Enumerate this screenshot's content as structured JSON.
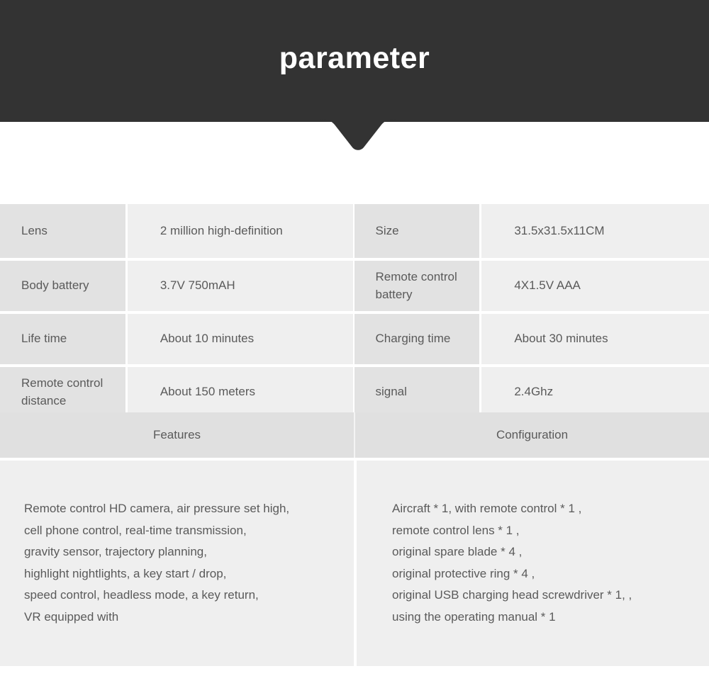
{
  "header": {
    "title": "parameter",
    "background_color": "#333333",
    "text_color": "#ffffff"
  },
  "spec_table": {
    "rows": [
      {
        "left_label": "Lens",
        "left_value": "2 million high-definition",
        "right_label": "Size",
        "right_value": "31.5x31.5x11CM"
      },
      {
        "left_label": "Body battery",
        "left_value": "3.7V 750mAH",
        "right_label": "Remote control battery",
        "right_value": "4X1.5V AAA"
      },
      {
        "left_label": "Life time",
        "left_value": "About 10 minutes",
        "right_label": "Charging time",
        "right_value": "About 30 minutes"
      },
      {
        "left_label": "Remote control distance",
        "left_value": "About 150 meters",
        "right_label": "signal",
        "right_value": "2.4Ghz"
      }
    ]
  },
  "sections": {
    "features_heading": "Features",
    "configuration_heading": "Configuration",
    "features_lines": [
      "Remote control HD camera, air pressure set high,",
      "cell phone control, real-time transmission,",
      "gravity sensor, trajectory planning,",
      "highlight nightlights, a key start / drop,",
      "speed control, headless mode, a key return,",
      "VR equipped with"
    ],
    "configuration_lines": [
      "Aircraft * 1, with remote control * 1 ,",
      "remote control lens * 1 ,",
      "original spare blade * 4 ,",
      "original protective ring * 4 ,",
      "original USB charging head screwdriver * 1, ,",
      "using the operating manual * 1"
    ]
  },
  "colors": {
    "label_cell": "#e2e2e2",
    "value_cell": "#efefef",
    "section_head": "#e0e0e0",
    "text": "#5a5a5a"
  }
}
